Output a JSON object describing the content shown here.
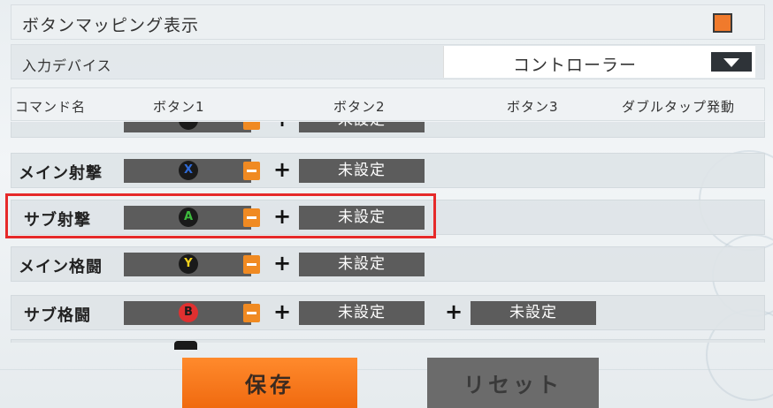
{
  "header": {
    "title": "ボタンマッピング表示",
    "checkbox_checked": true,
    "accent_color": "#f07a2c"
  },
  "device": {
    "label": "入力デバイス",
    "value": "コントローラー"
  },
  "columns": [
    "コマンド名",
    "ボタン1",
    "ボタン2",
    "ボタン3",
    "ダブルタップ発動"
  ],
  "rows": [
    {
      "name": "",
      "button": "",
      "button_color": "#ffffff",
      "unset1": "未設定"
    },
    {
      "name": "メイン射撃",
      "button": "X",
      "button_color": "#2f6bd8",
      "unset1": "未設定"
    },
    {
      "name": "サブ射撃",
      "button": "A",
      "button_color": "#3dbb3d",
      "unset1": "未設定"
    },
    {
      "name": "メイン格闘",
      "button": "Y",
      "button_color": "#f2d21e",
      "unset1": "未設定"
    },
    {
      "name": "サブ格闘",
      "button": "B",
      "button_color": "#e03030",
      "unset1": "未設定",
      "unset2": "未設定"
    }
  ],
  "actions": {
    "save": "保存",
    "reset": "リセット"
  }
}
